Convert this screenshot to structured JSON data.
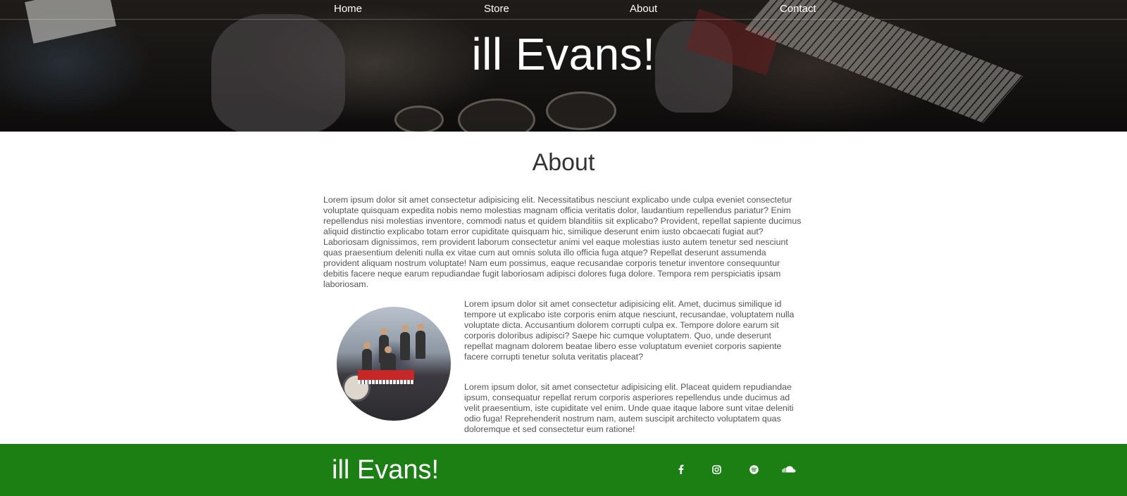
{
  "nav": {
    "items": [
      {
        "label": "Home"
      },
      {
        "label": "Store"
      },
      {
        "label": "About"
      },
      {
        "label": "Contact"
      }
    ]
  },
  "hero": {
    "title": "ill Evans!"
  },
  "about": {
    "heading": "About",
    "paragraph_1": "Lorem ipsum dolor sit amet consectetur adipisicing elit. Necessitatibus nesciunt explicabo unde culpa eveniet consectetur voluptate quisquam expedita nobis nemo molestias magnam officia veritatis dolor, laudantium repellendus pariatur? Enim repellendus nisi molestias inventore, commodi natus et quidem blanditiis sit explicabo? Provident, repellat sapiente ducimus aliquid distinctio explicabo totam error cupiditate quisquam hic, similique deserunt enim iusto obcaecati fugiat aut? Laboriosam dignissimos, rem provident laborum consectetur animi vel eaque molestias iusto autem tenetur sed nesciunt quas praesentium deleniti nulla ex vitae cum aut omnis soluta illo officia fuga atque? Repellat deserunt assumenda provident aliquam nostrum voluptate! Nam eum possimus, eaque recusandae corporis tenetur inventore consequuntur debitis facere neque earum repudiandae fugit laboriosam adipisci dolores fuga dolore. Tempora rem perspiciatis ipsam laboriosam.",
    "paragraph_2": "Lorem ipsum dolor sit amet consectetur adipisicing elit. Amet, ducimus similique id tempore ut explicabo iste corporis enim atque nesciunt, recusandae, voluptatem nulla voluptate dicta. Accusantium dolorem corrupti culpa ex. Tempore dolore earum sit corporis doloribus adipisci? Saepe hic cumque voluptatem. Quo, unde deserunt repellat magnam dolorem beatae libero esse voluptatum eveniet corporis sapiente facere corrupti tenetur soluta veritatis placeat?",
    "paragraph_3": "Lorem ipsum dolor, sit amet consectetur adipisicing elit. Placeat quidem repudiandae ipsum, consequatur repellat rerum corporis asperiores repellendus unde ducimus ad velit praesentium, iste cupiditate vel enim. Unde quae itaque labore sunt vitae deleniti odio fuga! Reprehenderit nostrum nam, autem suscipit architecto voluptatem quas doloremque et sed consectetur eum ratione!"
  },
  "footer": {
    "title": "ill Evans!",
    "social_icons": [
      "facebook-icon",
      "instagram-icon",
      "spotify-icon",
      "soundcloud-icon"
    ],
    "background_color": "#1b7f14"
  }
}
